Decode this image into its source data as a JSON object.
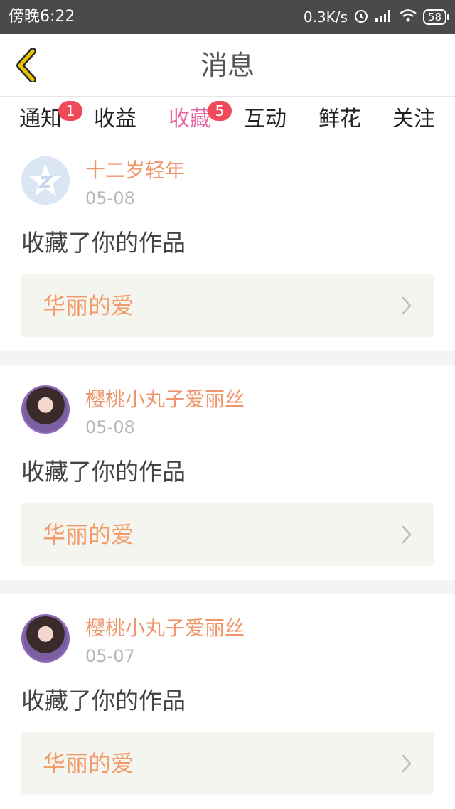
{
  "status_bar": {
    "left_text": "傍晚6:22",
    "speed": "0.3K/s",
    "battery": "58",
    "icons": [
      "alarm-icon",
      "signal-icon",
      "wifi-icon",
      "battery-icon"
    ]
  },
  "header": {
    "title": "消息",
    "back_icon": "back-chevron-icon",
    "accent_color": "#e8c400"
  },
  "tabs": [
    {
      "label": "通知",
      "badge": "1"
    },
    {
      "label": "收益",
      "badge": ""
    },
    {
      "label": "收藏",
      "badge": "5",
      "active": true
    },
    {
      "label": "互动",
      "badge": ""
    },
    {
      "label": "鲜花",
      "badge": ""
    },
    {
      "label": "关注",
      "badge": ""
    }
  ],
  "items": [
    {
      "user": "十二岁轻年",
      "date": "05-08",
      "action": "收藏了你的作品",
      "work": "华丽的爱",
      "avatar": "default-avatar-icon"
    },
    {
      "user": "樱桃小丸子爱丽丝",
      "date": "05-08",
      "action": "收藏了你的作品",
      "work": "华丽的爱",
      "avatar": "user-avatar"
    },
    {
      "user": "樱桃小丸子爱丽丝",
      "date": "05-07",
      "action": "收藏了你的作品",
      "work": "华丽的爱",
      "avatar": "user-avatar"
    }
  ],
  "colors": {
    "active_tab": "#e76aa6",
    "username": "#f0956b",
    "badge": "#f04a5a",
    "card_bg": "#f5f5ef"
  }
}
